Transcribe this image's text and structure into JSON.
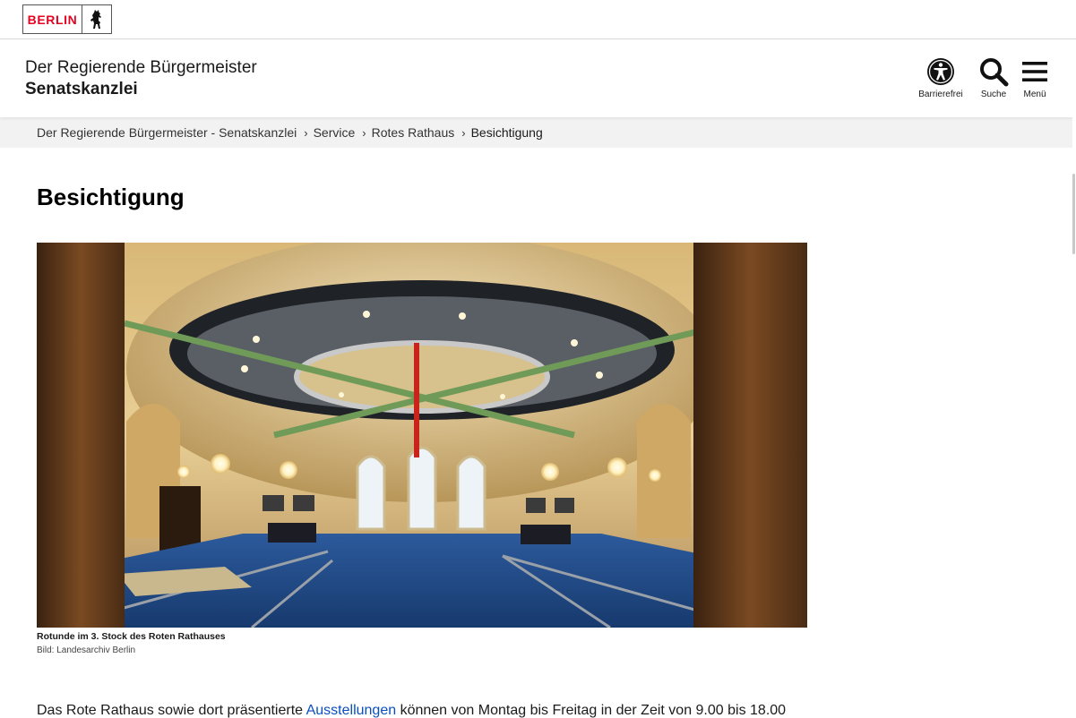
{
  "brand": {
    "logo_text": "BERLIN",
    "color": "#e40422"
  },
  "header": {
    "org_line1": "Der Regierende Bürgermeister",
    "org_line2": "Senatskanzlei",
    "tools": [
      {
        "label": "Barrierefrei",
        "icon": "accessibility-icon"
      },
      {
        "label": "Suche",
        "icon": "search-icon"
      },
      {
        "label": "Menü",
        "icon": "hamburger-menu-icon"
      }
    ]
  },
  "breadcrumb": [
    {
      "label": "Der Regierende Bürgermeister - Senatskanzlei"
    },
    {
      "label": "Service"
    },
    {
      "label": "Rotes Rathaus"
    },
    {
      "label": "Besichtigung"
    }
  ],
  "page": {
    "title": "Besichtigung",
    "image": {
      "caption": "Rotunde im 3. Stock des Roten Rathauses",
      "credit": "Bild: Landesarchiv Berlin"
    },
    "intro_before": "Das Rote Rathaus sowie dort präsentierte ",
    "intro_link": "Ausstellungen",
    "intro_after": " können von Montag bis Freitag in der Zeit von 9.00 bis 18.00"
  },
  "colors": {
    "link": "#0b4fbd",
    "breadcrumb_bg": "#f2f2f2"
  }
}
